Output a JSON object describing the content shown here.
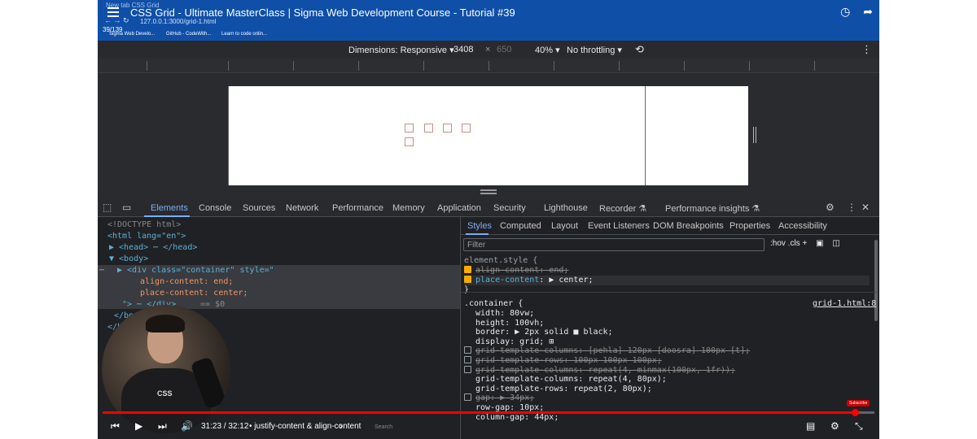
{
  "video": {
    "title": "CSS Grid - Ultimate MasterClass | Sigma Web Development Course - Tutorial #39",
    "counter": "39/139",
    "time": "31:23 / 32:12",
    "chapter": "• justify-content & align-content",
    "chapter_arrow": "›",
    "progress": 0.975,
    "subscribe": "Subscribe"
  },
  "browser": {
    "tabs_ghost": "New tab          CSS Grid",
    "url": "127.0.0.1:3000/grid-1.html",
    "nav": "←  →  ↻",
    "bookmarks": [
      "Sigma Web Develo...",
      "GitHub - CodeWith...",
      "Learn to code onlin..."
    ]
  },
  "device_toolbar": {
    "dimensions_label": "Dimensions: Responsive ▾",
    "width": "3408",
    "times": "×",
    "height": "650",
    "zoom": "40% ▾",
    "throttling": "No throttling ▾"
  },
  "devtools": {
    "tabs": [
      "Elements",
      "Console",
      "Sources",
      "Network",
      "Performance",
      "Memory",
      "Application",
      "Security",
      "Lighthouse",
      "Recorder ⚗",
      "Performance insights ⚗"
    ],
    "active_tab": "Elements"
  },
  "elements": {
    "lines": {
      "doctype": "<!DOCTYPE html>",
      "html_open": "<html lang=\"en\">",
      "head": "▶ <head> ⋯ </head>",
      "body": "▼ <body>",
      "dots": "⋯",
      "div_open": "▶ <div class=\"container\" style=\"",
      "align": "align-content: end;",
      "place": "place-content: center;",
      "close_div": "\"> ⋯ </div>",
      "eq": "== $0",
      "body_close": "</body>",
      "html_close": "</html>"
    }
  },
  "styles": {
    "tabs": [
      "Styles",
      "Computed",
      "Layout",
      "Event Listeners",
      "DOM Breakpoints",
      "Properties",
      "Accessibility"
    ],
    "filter_placeholder": "Filter",
    "tools": ":hov  .cls  +",
    "element_style": "element.style {",
    "es_align": "align-content: end;",
    "es_place_prop": "place-content",
    "es_place_val": ": ▶ center;",
    "close": "}",
    "container_sel": ".container {",
    "source": "grid-1.html:8",
    "rules": [
      {
        "text": "width: 80vw;",
        "strike": false,
        "checkbox": false
      },
      {
        "text": "height: 100vh;",
        "strike": false,
        "checkbox": false
      },
      {
        "text": "border: ▶ 2px solid ■ black;",
        "strike": false,
        "checkbox": false
      },
      {
        "text": "display: grid; ⊞",
        "strike": false,
        "checkbox": false
      },
      {
        "text": "grid-template-columns: [pehla] 120px [doosra] 100px [t];",
        "strike": true,
        "checkbox": true
      },
      {
        "text": "grid-template-rows: 100px 100px 100px;",
        "strike": true,
        "checkbox": true
      },
      {
        "text": "grid-template-columns: repeat(4, minmax(100px, 1fr));",
        "strike": true,
        "checkbox": true
      },
      {
        "text": "grid-template-columns: repeat(4, 80px);",
        "strike": false,
        "checkbox": false
      },
      {
        "text": "grid-template-rows: repeat(2, 80px);",
        "strike": false,
        "checkbox": false
      },
      {
        "text": "gap: ▶ 34px;",
        "strike": true,
        "checkbox": true
      },
      {
        "text": "row-gap: 10px;",
        "strike": false,
        "checkbox": false
      },
      {
        "text": "column-gap: 44px;",
        "strike": false,
        "checkbox": false
      }
    ]
  },
  "webcam": {
    "shirt_logo": "CSS"
  },
  "taskbar": {
    "search": "Search"
  },
  "colors": {
    "accent": "#7cacf8",
    "youtube_red": "#ff0000",
    "chrome_blue": "#0f4fa8"
  }
}
